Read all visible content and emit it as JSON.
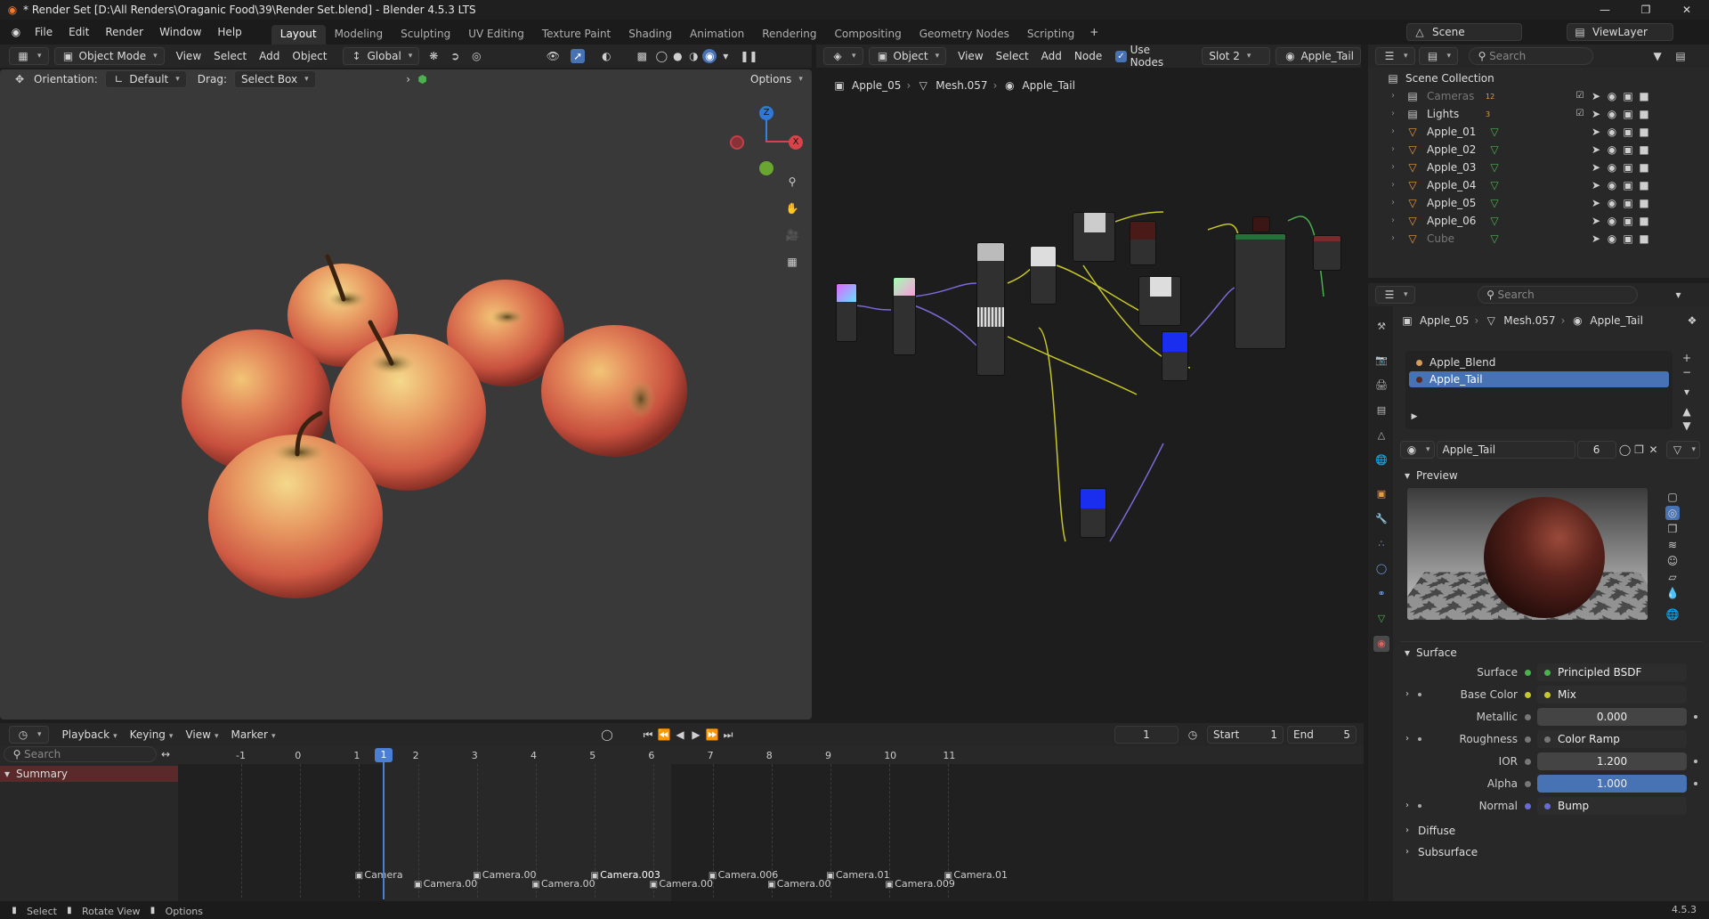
{
  "window": {
    "title": "* Render Set [D:\\All Renders\\Oraganic Food\\39\\Render Set.blend] - Blender 4.5.3 LTS"
  },
  "menus": [
    "File",
    "Edit",
    "Render",
    "Window",
    "Help"
  ],
  "workspaces": [
    "Layout",
    "Modeling",
    "Sculpting",
    "UV Editing",
    "Texture Paint",
    "Shading",
    "Animation",
    "Rendering",
    "Compositing",
    "Geometry Nodes",
    "Scripting"
  ],
  "active_workspace": "Layout",
  "scene": {
    "name": "Scene",
    "view_layer": "ViewLayer",
    "search_placeholder": "Search"
  },
  "viewport": {
    "mode": "Object Mode",
    "menus": [
      "View",
      "Select",
      "Add",
      "Object"
    ],
    "transform_space": "Global",
    "orientation_label": "Orientation:",
    "orientation": "Default",
    "drag_label": "Drag:",
    "drag": "Select Box",
    "options": "Options",
    "gizmo": {
      "z": "Z",
      "x": "X"
    }
  },
  "node_editor": {
    "type": "Object",
    "menus": [
      "View",
      "Select",
      "Add",
      "Node"
    ],
    "use_nodes": "Use Nodes",
    "slot": "Slot 2",
    "material": "Apple_Tail",
    "breadcrumb": [
      "Apple_05",
      "Mesh.057",
      "Apple_Tail"
    ]
  },
  "outliner": {
    "root": "Scene Collection",
    "items": [
      {
        "name": "Cameras",
        "dim": true,
        "badge": "12"
      },
      {
        "name": "Lights",
        "dim": false,
        "badge": "3"
      },
      {
        "name": "Apple_01",
        "dim": false
      },
      {
        "name": "Apple_02",
        "dim": false
      },
      {
        "name": "Apple_03",
        "dim": false
      },
      {
        "name": "Apple_04",
        "dim": false
      },
      {
        "name": "Apple_05",
        "dim": false
      },
      {
        "name": "Apple_06",
        "dim": false
      },
      {
        "name": "Cube",
        "dim": true
      }
    ]
  },
  "properties": {
    "search_placeholder": "Search",
    "breadcrumb": [
      "Apple_05",
      "Mesh.057",
      "Apple_Tail"
    ],
    "slots": [
      {
        "name": "Apple_Blend",
        "selected": false
      },
      {
        "name": "Apple_Tail",
        "selected": true
      }
    ],
    "material_name": "Apple_Tail",
    "users": "6",
    "preview_label": "Preview",
    "surface_panel": "Surface",
    "rows": [
      {
        "label": "Surface",
        "value": "Principled BSDF",
        "kind": "link",
        "dot": "#4caf50"
      },
      {
        "label": "Base Color",
        "value": "Mix",
        "kind": "link",
        "dot": "#c7c729",
        "expand": true
      },
      {
        "label": "Metallic",
        "value": "0.000",
        "kind": "num",
        "dot": "#777"
      },
      {
        "label": "Roughness",
        "value": "Color Ramp",
        "kind": "link",
        "dot": "#777",
        "expand": true
      },
      {
        "label": "IOR",
        "value": "1.200",
        "kind": "num",
        "dot": "#777"
      },
      {
        "label": "Alpha",
        "value": "1.000",
        "kind": "slider",
        "dot": "#777"
      },
      {
        "label": "Normal",
        "value": "Bump",
        "kind": "link",
        "dot": "#6a6ad6",
        "expand": true
      }
    ],
    "subpanels": [
      "Diffuse",
      "Subsurface"
    ]
  },
  "timeline": {
    "menus": [
      "Playback",
      "Keying",
      "View",
      "Marker"
    ],
    "current_frame": "1",
    "start_label": "Start",
    "start": "1",
    "end_label": "End",
    "end": "5",
    "search_placeholder": "Search",
    "summary": "Summary",
    "ticks": [
      "-1",
      "0",
      "1",
      "2",
      "3",
      "4",
      "5",
      "6",
      "7",
      "8",
      "9",
      "10",
      "11"
    ],
    "markers": [
      "Camera",
      "Camera.00",
      "Camera.00",
      "Camera.00",
      "Camera.003",
      "Camera.00",
      "Camera.006",
      "Camera.00",
      "Camera.01",
      "Camera.009",
      "Camera.01"
    ]
  },
  "status": {
    "items": [
      "Select",
      "Rotate View",
      "Options"
    ],
    "version": "4.5.3"
  }
}
